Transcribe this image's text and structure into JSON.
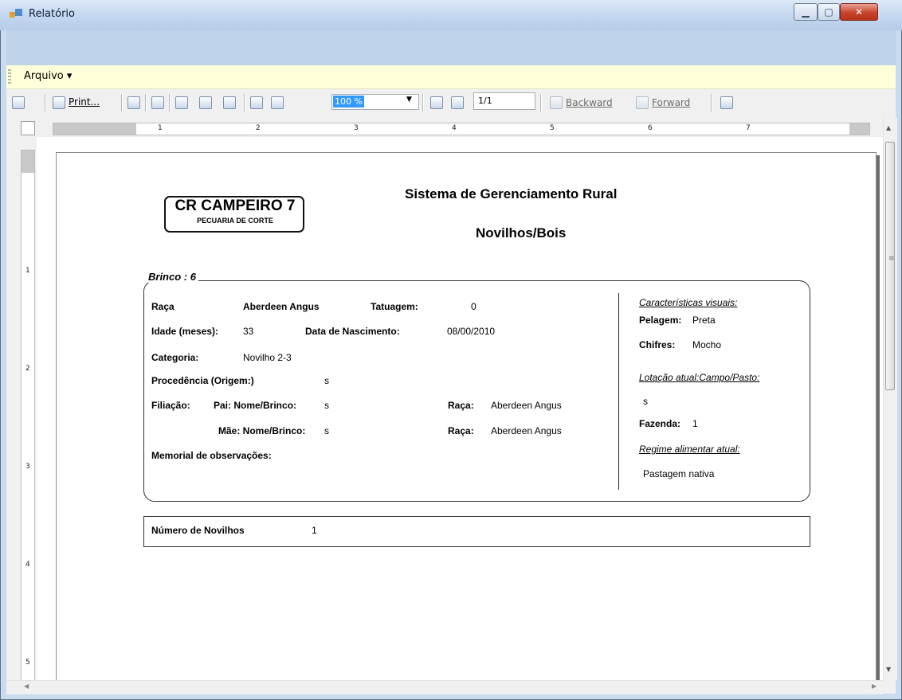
{
  "window": {
    "title": "Relatório"
  },
  "menu": {
    "arquivo": "Arquivo ▾"
  },
  "toolbar": {
    "print_label": "Print...",
    "zoom_value": "100 %",
    "page_value": "1/1",
    "backward_label": "Backward",
    "forward_label": "Forward"
  },
  "ruler": {
    "h_numbers": [
      "1",
      "2",
      "3",
      "4",
      "5",
      "6",
      "7"
    ],
    "v_numbers": [
      "1",
      "2",
      "3",
      "4",
      "5"
    ]
  },
  "report": {
    "logo_line1": "CR CAMPEIRO 7",
    "logo_line2": "PECUARIA DE CORTE",
    "title": "Sistema de Gerenciamento Rural",
    "subtitle": "Novilhos/Bois",
    "brinco": "Brinco :  6",
    "raca_label": "Raça",
    "raca_value": "Aberdeen Angus",
    "tatuagem_label": "Tatuagem:",
    "tatuagem_value": "0",
    "idade_label": "Idade (meses):",
    "idade_value": "33",
    "nascimento_label": "Data de Nascimento:",
    "nascimento_value": "08/00/2010",
    "categoria_label": "Categoria:",
    "categoria_value": "Novilho 2-3",
    "procedencia_label": "Procedência (Origem:)",
    "procedencia_value": "s",
    "filiacao_label": "Filiação:",
    "pai_label": "Pai: Nome/Brinco:",
    "pai_value": "s",
    "pai_raca_label": "Raça:",
    "pai_raca_value": "Aberdeen Angus",
    "mae_label": "Mãe: Nome/Brinco:",
    "mae_value": "s",
    "mae_raca_label": "Raça:",
    "mae_raca_value": "Aberdeen Angus",
    "memorial_label": "Memorial de observações:",
    "caracteristicas_label": "Características visuais:",
    "pelagem_label": "Pelagem:",
    "pelagem_value": "Preta",
    "chifres_label": "Chifres:",
    "chifres_value": "Mocho",
    "lotacao_label": "Lotação atual:Campo/Pasto:",
    "lotacao_value": "s",
    "fazenda_label": "Fazenda:",
    "fazenda_value": "1",
    "regime_label": "Regime alimentar atual:",
    "regime_value": "Pastagem nativa",
    "numero_label": "Número de Novilhos",
    "numero_value": "1"
  }
}
